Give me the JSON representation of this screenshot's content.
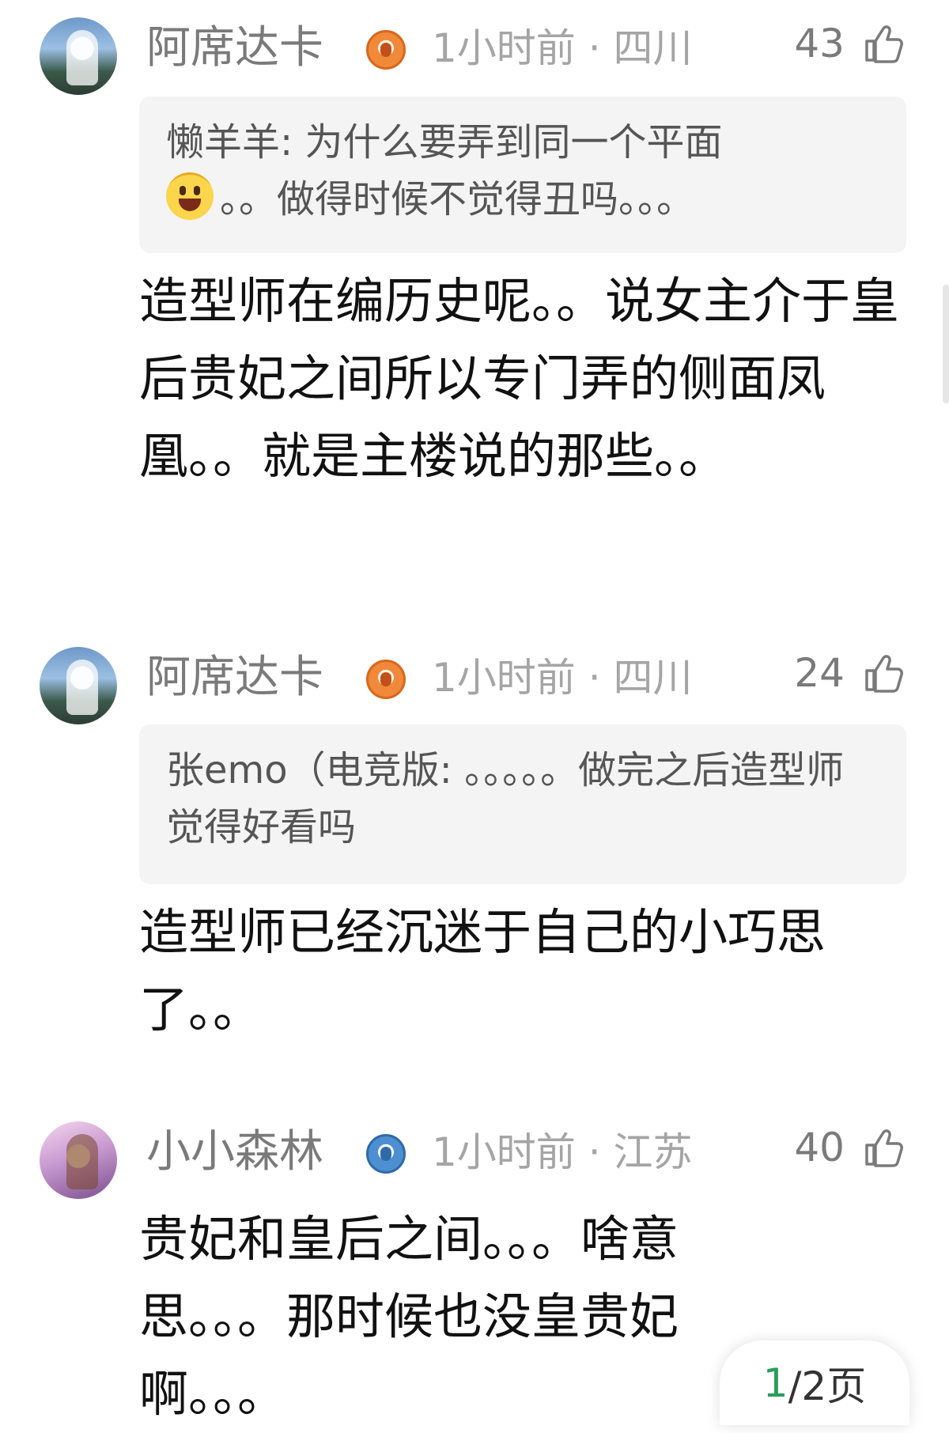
{
  "comments": [
    {
      "user": "阿席达卡",
      "meta": "1小时前 · 四川",
      "likes": "43",
      "badge_icon": "orange-bird-badge-icon",
      "quote": {
        "author": "懒羊羊:",
        "text_before_emoji": " 为什么要弄到同一个平面",
        "text_after_emoji": "。。做得时候不觉得丑吗。。。"
      },
      "text": "造型师在编历史呢。。说女主介于皇后贵妃之间所以专门弄的侧面凤凰。。就是主楼说的那些。。"
    },
    {
      "user": "阿席达卡",
      "meta": "1小时前 · 四川",
      "likes": "24",
      "badge_icon": "orange-bird-badge-icon",
      "quote": {
        "author": "张emo（电竞版:",
        "text": " 。。。。。做完之后造型师觉得好看吗"
      },
      "text": "造型师已经沉迷于自己的小巧思了。。"
    },
    {
      "user": "小小森林",
      "meta": "1小时前 · 江苏",
      "likes": "40",
      "badge_icon": "blue-bird-badge-icon",
      "text": "贵妃和皇后之间。。。啥意思。。。那时候也没皇贵妃啊。。。"
    }
  ],
  "pager": {
    "current": "1",
    "rest": "/2页"
  },
  "colors": {
    "username": "#7a7a7a",
    "meta": "#a5a5a5",
    "quote_bg": "#f4f4f4",
    "pager_current": "#2a9d5a"
  }
}
